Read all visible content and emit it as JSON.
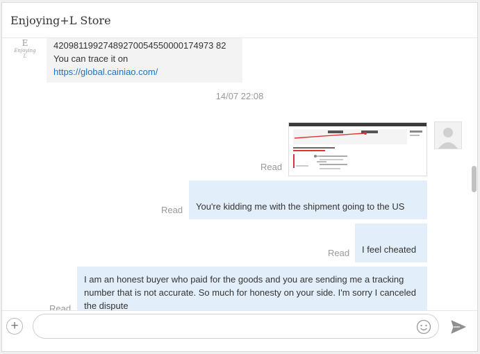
{
  "header": {
    "title": "Enjoying+L Store"
  },
  "store_logo": {
    "mark": "E",
    "caption": "Enjoying L"
  },
  "incoming": {
    "tracking_number": "42098119927489270054550000174973 82",
    "trace_text": "You can trace it on",
    "link": "https://global.cainiao.com/"
  },
  "timestamp": "14/07 22:08",
  "outgoing": [
    {
      "status": "Read",
      "kind": "image"
    },
    {
      "status": "Read",
      "text": "You're kidding me with the shipment going to the US"
    },
    {
      "status": "Read",
      "text": "I feel cheated"
    },
    {
      "status": "Read",
      "text": "I am an honest buyer who paid for the goods and you are sending me a tracking number that is not accurate. So much for honesty on your side. I'm sorry I canceled the dispute"
    }
  ],
  "composer": {
    "placeholder": ""
  },
  "colors": {
    "outgoing_bubble": "#e3eefb",
    "incoming_bubble": "#f3f3f3",
    "link": "#1a73c8"
  },
  "icons": {
    "add": "plus-circle-icon",
    "emoji": "smiley-icon",
    "send": "paper-plane-icon"
  }
}
